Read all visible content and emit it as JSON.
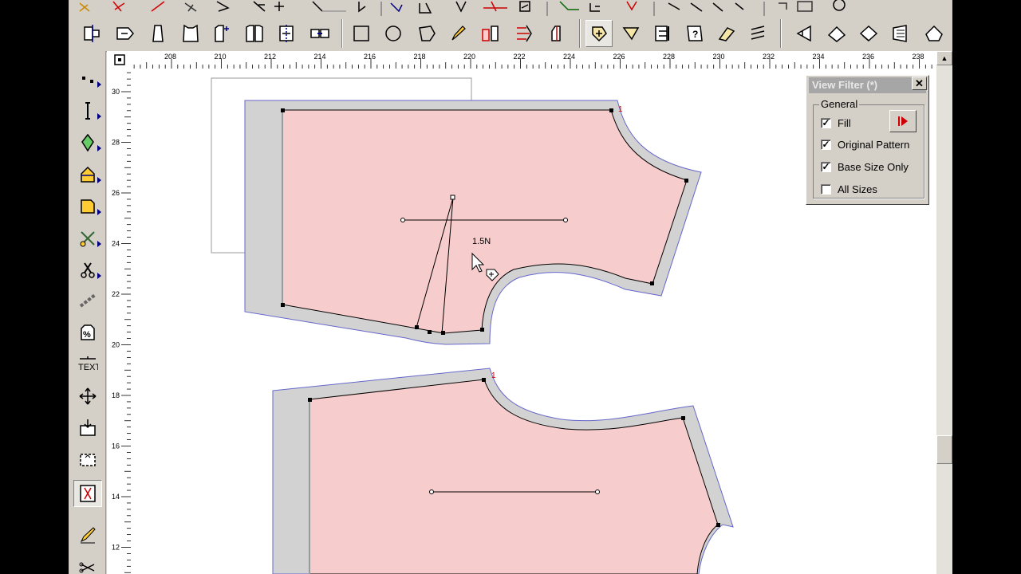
{
  "colors": {
    "piece_fill": "#f7cccc",
    "seam_allowance": "#d2d2d2",
    "outline": "#6666cc",
    "accent_red": "#cc0000"
  },
  "ruler": {
    "top_labels": [
      "208",
      "210",
      "212",
      "214",
      "216",
      "218",
      "220",
      "222",
      "224",
      "226",
      "228",
      "230",
      "232",
      "234",
      "236",
      "238"
    ],
    "left_labels": [
      "30",
      "28",
      "26",
      "24",
      "22",
      "20",
      "18",
      "16",
      "14",
      "12"
    ]
  },
  "canvas": {
    "measure_label": "1.5N",
    "piece_number_1": "1",
    "piece_number_2": "1"
  },
  "toolbar": {
    "text_tool_label": "TEXT"
  },
  "view_filter": {
    "title": "View Filter (*)",
    "close_label": "✕",
    "group_label": "General",
    "options": [
      {
        "label": "Fill",
        "checked": true,
        "mark": "✓"
      },
      {
        "label": "Original Pattern",
        "checked": true,
        "mark": "✓"
      },
      {
        "label": "Base Size Only",
        "checked": true,
        "mark": "✓"
      },
      {
        "label": "All Sizes",
        "checked": false,
        "mark": ""
      }
    ]
  }
}
